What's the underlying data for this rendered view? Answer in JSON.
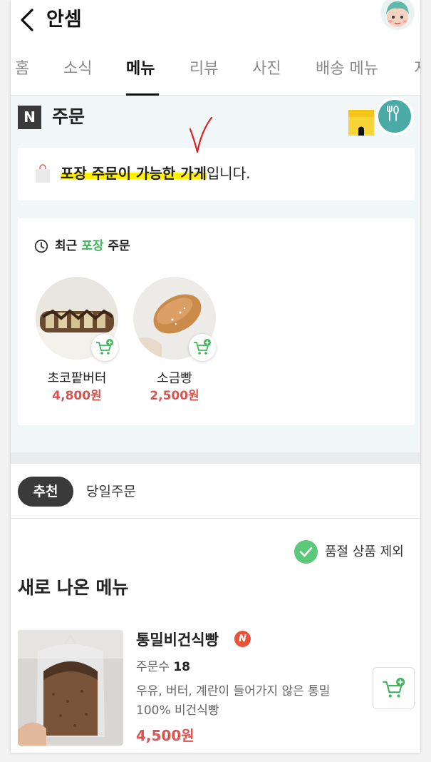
{
  "header": {
    "title": "안셈",
    "back_icon": "chevron-left-icon",
    "avatar_icon": "user-avatar"
  },
  "tabs": [
    {
      "label": "홈",
      "active": false
    },
    {
      "label": "소식",
      "active": false
    },
    {
      "label": "메뉴",
      "active": true
    },
    {
      "label": "리뷰",
      "active": false
    },
    {
      "label": "사진",
      "active": false
    },
    {
      "label": "배송 메뉴",
      "active": false
    },
    {
      "label": "지",
      "active": false
    }
  ],
  "order": {
    "badge": "N",
    "title": "주문",
    "takeout_notice": {
      "highlight": "포장 주문이 가능한 가게",
      "rest": "입니다."
    },
    "recent": {
      "title_pre": "최근 ",
      "title_green": "포장",
      "title_post": " 주문",
      "items": [
        {
          "name": "초코팥버터",
          "price": "4,800원"
        },
        {
          "name": "소금빵",
          "price": "2,500원"
        }
      ]
    }
  },
  "filters": {
    "active": "추천",
    "other": "당일주문"
  },
  "soldout_filter": {
    "label": "품절 상품 제외",
    "checked": true
  },
  "section": {
    "title": "새로 나온 메뉴"
  },
  "menu_items": [
    {
      "name": "통밀비건식빵",
      "badge": "N",
      "order_count_label": "주문수",
      "order_count": "18",
      "description": "우유, 버터, 계란이 들어가지 않은 통밀 100% 비건식빵",
      "price": "4,500원"
    }
  ],
  "colors": {
    "accent_green": "#3fb65a",
    "price_red": "#d9534f",
    "highlight_yellow": "#fff100",
    "teal": "#4aaaa5"
  }
}
